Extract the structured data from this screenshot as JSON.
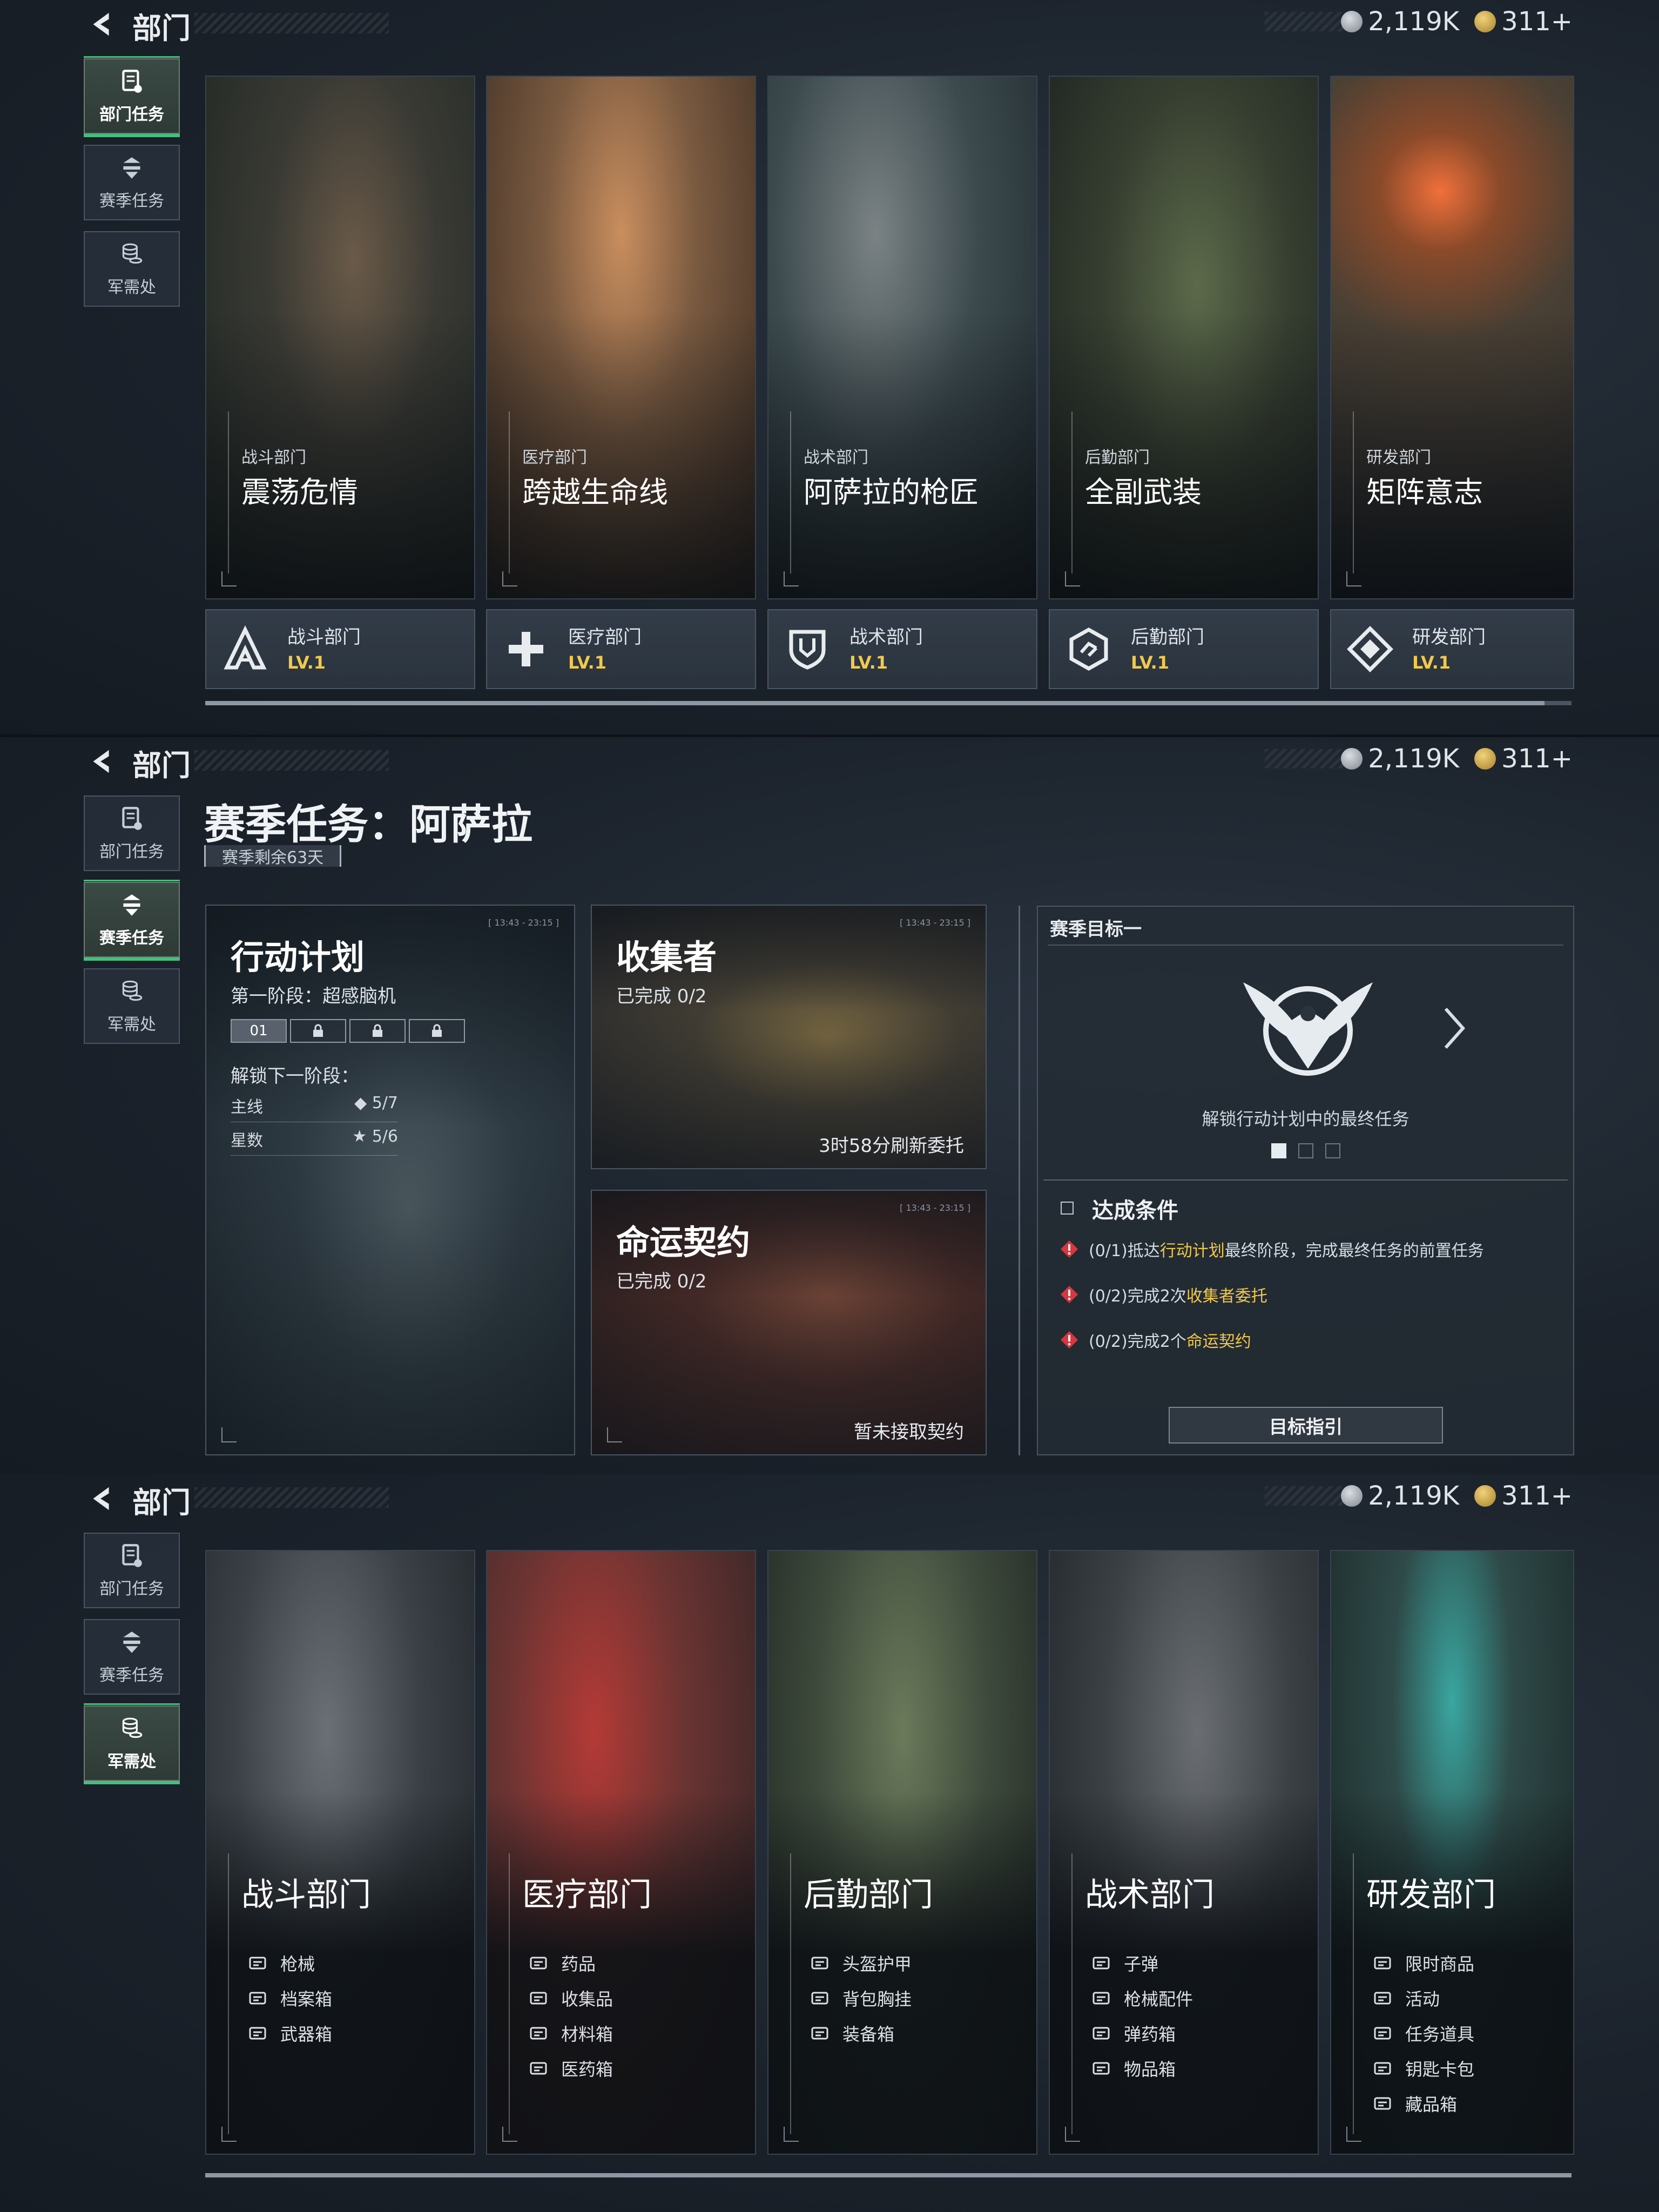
{
  "header": {
    "back_label": "<",
    "title": "部门",
    "silver": "2,119K",
    "gold": "311+"
  },
  "nav": [
    {
      "label": "部门任务",
      "icon": "mission-doc-icon"
    },
    {
      "label": "赛季任务",
      "icon": "season-badge-icon"
    },
    {
      "label": "军需处",
      "icon": "coin-stack-icon"
    }
  ],
  "departments": [
    {
      "sub": "战斗部门",
      "name": "震荡危情",
      "plate": "战斗部门",
      "level": "LV.1",
      "icon": "combat-icon",
      "color": "#4a5a4c"
    },
    {
      "sub": "医疗部门",
      "name": "跨越生命线",
      "plate": "医疗部门",
      "level": "LV.1",
      "icon": "medical-cross-icon",
      "color": "#8a6a4a"
    },
    {
      "sub": "战术部门",
      "name": "阿萨拉的枪匠",
      "plate": "战术部门",
      "level": "LV.1",
      "icon": "tactical-shield-icon",
      "color": "#3c4c50"
    },
    {
      "sub": "后勤部门",
      "name": "全副武装",
      "plate": "后勤部门",
      "level": "LV.1",
      "icon": "logistics-hex-icon",
      "color": "#3e4a3a"
    },
    {
      "sub": "研发部门",
      "name": "矩阵意志",
      "plate": "研发部门",
      "level": "LV.1",
      "icon": "research-diamond-icon",
      "color": "#5a4a38"
    }
  ],
  "season": {
    "title": "赛季任务：阿萨拉",
    "remaining": "赛季剩余63天",
    "plan": {
      "title": "行动计划",
      "stage": "第一阶段：超感脑机",
      "stages": [
        "01",
        "",
        "",
        ""
      ],
      "unlock_label": "解锁下一阶段：",
      "main_label": "主线",
      "main_value": "◆ 5/7",
      "star_label": "星数",
      "star_value": "★ 5/6",
      "time": "[ 13:43 - 23:15 ]"
    },
    "collector": {
      "title": "收集者",
      "progress": "已完成 0/2",
      "refresh": "3时58分刷新委托",
      "time": "[ 13:43 - 23:15 ]"
    },
    "fate": {
      "title": "命运契约",
      "progress": "已完成 0/2",
      "status": "暂未接取契约",
      "time": "[ 13:43 - 23:15 ]"
    },
    "goal": {
      "header": "赛季目标一",
      "desc": "解锁行动计划中的最终任务",
      "cond_title": "达成条件",
      "conditions": [
        {
          "pre": "(0/1)抵达",
          "hl": "行动计划",
          "post": "最终阶段，完成最终任务的前置任务"
        },
        {
          "pre": "(0/2)完成2次",
          "hl": "收集者委托",
          "post": ""
        },
        {
          "pre": "(0/2)完成2个",
          "hl": "命运契约",
          "post": ""
        }
      ],
      "guide_button": "目标指引"
    }
  },
  "supply": [
    {
      "name": "战斗部门",
      "color": "#3a424a",
      "items": [
        {
          "label": "枪械",
          "icon": "rifle-icon"
        },
        {
          "label": "档案箱",
          "icon": "file-box-icon"
        },
        {
          "label": "武器箱",
          "icon": "weapon-case-icon"
        }
      ]
    },
    {
      "name": "医疗部门",
      "color": "#6a3a36",
      "items": [
        {
          "label": "药品",
          "icon": "syringe-icon"
        },
        {
          "label": "收集品",
          "icon": "collectible-icon"
        },
        {
          "label": "材料箱",
          "icon": "material-box-icon"
        },
        {
          "label": "医药箱",
          "icon": "medkit-icon"
        }
      ]
    },
    {
      "name": "后勤部门",
      "color": "#3e4a3c",
      "items": [
        {
          "label": "头盔护甲",
          "icon": "helmet-icon"
        },
        {
          "label": "背包胸挂",
          "icon": "backpack-icon"
        },
        {
          "label": "装备箱",
          "icon": "equipment-box-icon"
        }
      ]
    },
    {
      "name": "战术部门",
      "color": "#3a4044",
      "items": [
        {
          "label": "子弹",
          "icon": "bullet-icon"
        },
        {
          "label": "枪械配件",
          "icon": "gun-part-icon"
        },
        {
          "label": "弹药箱",
          "icon": "ammo-box-icon"
        },
        {
          "label": "物品箱",
          "icon": "item-box-icon"
        }
      ]
    },
    {
      "name": "研发部门",
      "color": "#2e4a48",
      "items": [
        {
          "label": "限时商品",
          "icon": "limited-goods-icon"
        },
        {
          "label": "活动",
          "icon": "event-icon"
        },
        {
          "label": "任务道具",
          "icon": "quest-item-icon"
        },
        {
          "label": "钥匙卡包",
          "icon": "keycard-icon"
        },
        {
          "label": "藏品箱",
          "icon": "collection-box-icon"
        }
      ]
    }
  ]
}
